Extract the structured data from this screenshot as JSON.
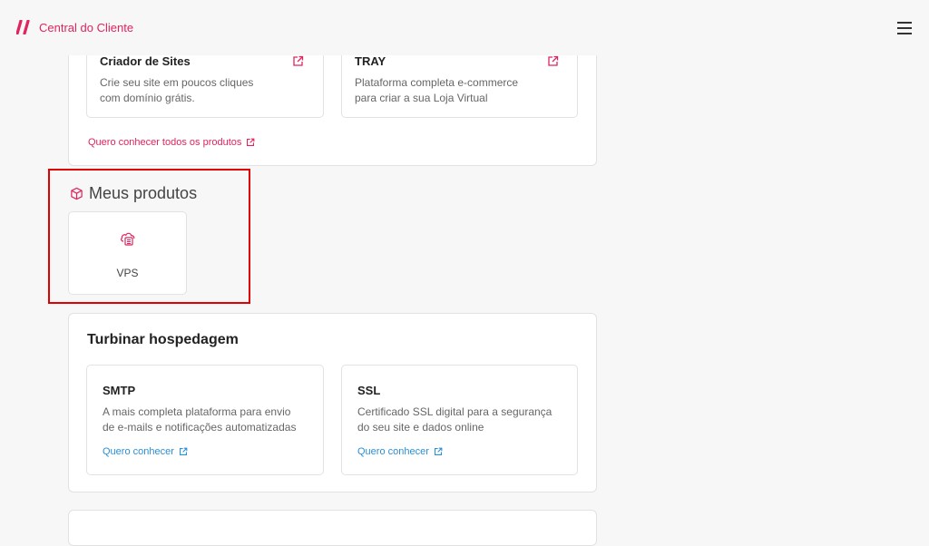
{
  "header": {
    "brand_title": "Central do Cliente",
    "brand_color": "#e0245e",
    "logo_icon": "double-slash-logo",
    "menu_icon": "hamburger-icon"
  },
  "offers": {
    "products": [
      {
        "title": "Criador de Sites",
        "description_line1": "Crie seu site em poucos cliques",
        "description_line2": "com domínio grátis."
      },
      {
        "title": "TRAY",
        "description_line1": "Plataforma completa e-commerce",
        "description_line2": "para criar a sua Loja Virtual"
      }
    ],
    "all_products_link": "Quero conhecer todos os produtos"
  },
  "my_products": {
    "title": "Meus produtos",
    "items": [
      {
        "label": "VPS",
        "icon": "cloud-server-icon"
      }
    ]
  },
  "boost": {
    "title": "Turbinar hospedagem",
    "items": [
      {
        "title": "SMTP",
        "description_line1": "A mais completa plataforma para envio",
        "description_line2": "de e-mails e notificações automatizadas",
        "link": "Quero conhecer"
      },
      {
        "title": "SSL",
        "description_line1": "Certificado SSL digital para a segurança",
        "description_line2": "do seu site e dados online",
        "link": "Quero conhecer"
      }
    ]
  },
  "colors": {
    "accent": "#e0245e",
    "link_blue": "#2a8fd4",
    "highlight": "#e00000"
  }
}
